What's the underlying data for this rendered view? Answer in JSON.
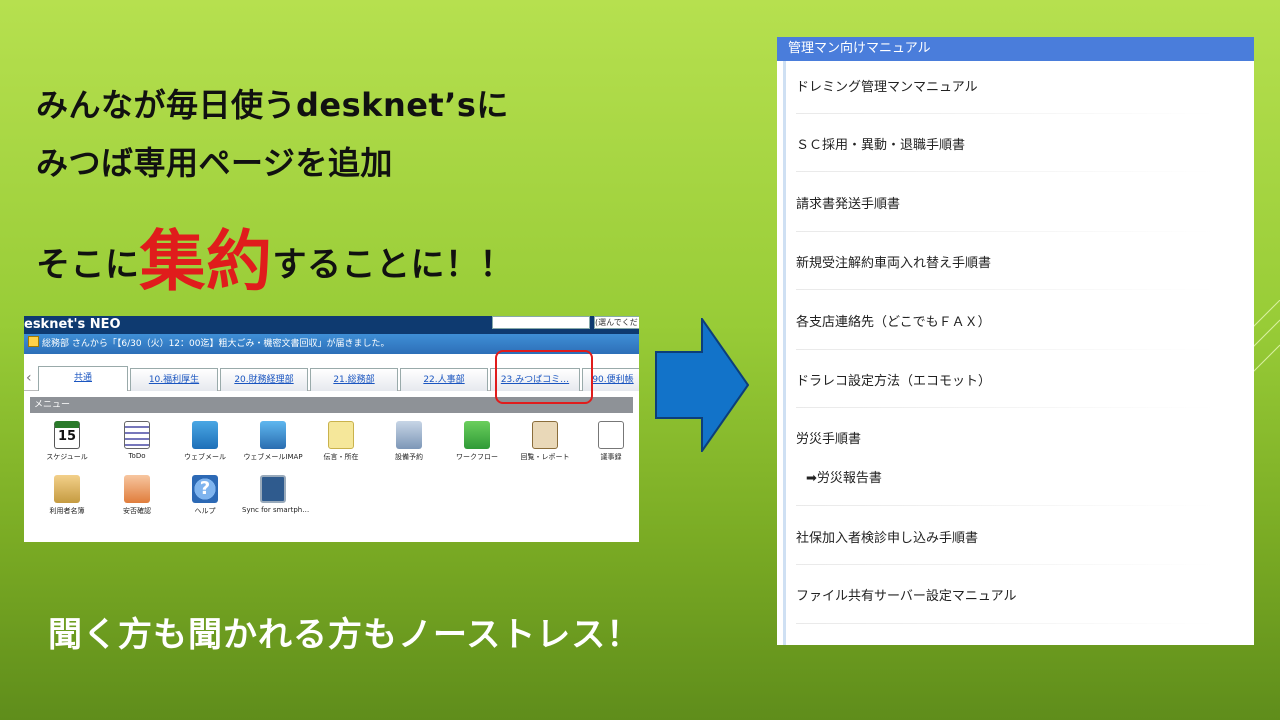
{
  "headline": {
    "line1": "みんなが毎日使うdesknet’sに",
    "line2": "みつば専用ページを追加",
    "line3_pre": "そこに",
    "line3_big": "集約",
    "line3_post": "することに！！"
  },
  "bottom_text": "聞く方も聞かれる方もノーストレス！",
  "desknets": {
    "logo": "esknet's NEO",
    "search_placeholder": "(選んでくだ",
    "notice": "総務部 さんから「【6/30（火）12：00迄】粗大ごみ・機密文書回収」が届きました。",
    "tabs": [
      "共通",
      "10.福利厚生",
      "20.財務経理部",
      "21.総務部",
      "22.人事部",
      "23.みつばコミ…",
      "90.便利帳"
    ],
    "menu_header": "メニュー",
    "calendar_day": "15",
    "help_glyph": "?",
    "menu_items": [
      {
        "label": "スケジュール",
        "icon": "calendar-icon"
      },
      {
        "label": "ToDo",
        "icon": "todo-icon"
      },
      {
        "label": "ウェブメール",
        "icon": "webmail-icon"
      },
      {
        "label": "ウェブメールIMAP",
        "icon": "webmail-imap-icon"
      },
      {
        "label": "伝言・所在",
        "icon": "memo-icon"
      },
      {
        "label": "設備予約",
        "icon": "facility-icon"
      },
      {
        "label": "ワークフロー",
        "icon": "workflow-icon"
      },
      {
        "label": "回覧・レポート",
        "icon": "report-icon"
      },
      {
        "label": "議事録",
        "icon": "minutes-icon"
      },
      {
        "label": "利用者名簿",
        "icon": "user-list-icon"
      },
      {
        "label": "安否確認",
        "icon": "safety-icon"
      },
      {
        "label": "ヘルプ",
        "icon": "help-icon"
      },
      {
        "label": "Sync for smartph…",
        "icon": "sync-icon"
      }
    ]
  },
  "manual": {
    "header": "管理マン向けマニュアル",
    "items": [
      "ドレミング管理マンマニュアル",
      "ＳＣ採用・異動・退職手順書",
      "請求書発送手順書",
      "新規受注解約車両入れ替え手順書",
      "各支店連絡先（どこでもＦＡＸ）",
      "ドラレコ設定方法（エコモット）",
      "労災手順書",
      "➡労災報告書",
      "社保加入者検診申し込み手順書",
      "ファイル共有サーバー設定マニュアル"
    ]
  },
  "colors": {
    "accent_red": "#e01c1c",
    "manual_header": "#4a7ddb",
    "arrow": "#1273c9"
  }
}
